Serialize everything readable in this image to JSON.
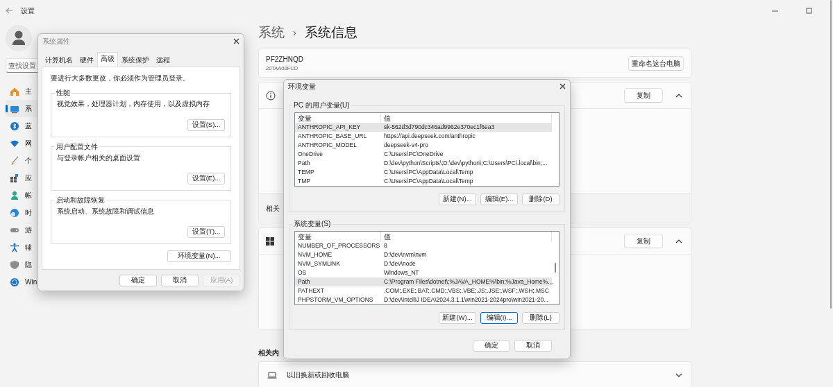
{
  "window": {
    "title": "设置"
  },
  "sidebar": {
    "search": {
      "placeholder": "查找设置"
    },
    "items": [
      {
        "label": "主",
        "selected": false
      },
      {
        "label": "系",
        "selected": true
      },
      {
        "label": "蓝",
        "selected": false
      },
      {
        "label": "网",
        "selected": false
      },
      {
        "label": "个",
        "selected": false
      },
      {
        "label": "应",
        "selected": false
      },
      {
        "label": "帐",
        "selected": false
      },
      {
        "label": "时",
        "selected": false
      },
      {
        "label": "游",
        "selected": false
      },
      {
        "label": "辅",
        "selected": false
      },
      {
        "label": "隐",
        "selected": false
      },
      {
        "label": "Win",
        "selected": false
      }
    ]
  },
  "page": {
    "breadcrumb": [
      "系统",
      "系统信息"
    ],
    "separator": "›",
    "device": {
      "name": "PF2ZHNQD",
      "model": "20TAA00FCD",
      "button": "重命名这台电脑"
    },
    "sections": [
      {
        "kind": "info",
        "button": "复制",
        "expanded": true,
        "footer": "相关"
      },
      {
        "kind": "windows",
        "button": "复制",
        "expanded": true
      }
    ],
    "related_heading": "相关内",
    "related_items": [
      {
        "label": "以旧换新或回收电脑",
        "expanded": false
      }
    ]
  },
  "system_properties": {
    "title": "系统属性",
    "active": false,
    "tabs": [
      {
        "label": "计算机名",
        "selected": false
      },
      {
        "label": "硬件",
        "selected": false
      },
      {
        "label": "高级",
        "selected": true
      },
      {
        "label": "系统保护",
        "selected": false
      },
      {
        "label": "远程",
        "selected": false
      }
    ],
    "notice": "要进行大多数更改，你必须作为管理员登录。",
    "groups": [
      {
        "title": "性能",
        "description": "视觉效果，处理器计划，内存使用，以及虚拟内存",
        "button": "设置(S)..."
      },
      {
        "title": "用户配置文件",
        "description": "与登录帐户相关的桌面设置",
        "button": "设置(E)..."
      },
      {
        "title": "启动和故障恢复",
        "description": "系统启动、系统故障和调试信息",
        "button": "设置(T)..."
      }
    ],
    "env_button": "环境变量(N)...",
    "buttons": [
      {
        "label": "确定",
        "disabled": false
      },
      {
        "label": "取消",
        "disabled": false
      },
      {
        "label": "应用(A)",
        "disabled": true
      }
    ]
  },
  "environment_variables": {
    "title": "环境变量",
    "active": true,
    "lists": [
      {
        "title": "PC 的用户变量(U)",
        "columns": [
          "变量",
          "值"
        ],
        "scrollbar": false,
        "rows": [
          {
            "name": "ANTHROPIC_API_KEY",
            "value": "sk-562d3d790dc346ad9962e370ec1f6ea3",
            "selected": true
          },
          {
            "name": "ANTHROPIC_BASE_URL",
            "value": "https://api.deepseek.com/anthropic",
            "selected": false
          },
          {
            "name": "ANTHROPIC_MODEL",
            "value": "deepseek-v4-pro",
            "selected": false
          },
          {
            "name": "OneDrive",
            "value": "C:\\Users\\PC\\OneDrive",
            "selected": false
          },
          {
            "name": "Path",
            "value": "D:\\dev\\python\\Scripts\\;D:\\dev\\python\\;C:\\Users\\PC\\.local\\bin;...",
            "selected": false
          },
          {
            "name": "TEMP",
            "value": "C:\\Users\\PC\\AppData\\Local\\Temp",
            "selected": false
          },
          {
            "name": "TMP",
            "value": "C:\\Users\\PC\\AppData\\Local\\Temp",
            "selected": false
          }
        ],
        "buttons": [
          {
            "label": "新建(N)...",
            "focused": false
          },
          {
            "label": "编辑(E)...",
            "focused": false
          },
          {
            "label": "删除(D)",
            "focused": false
          }
        ]
      },
      {
        "title": "系统变量(S)",
        "columns": [
          "变量",
          "值"
        ],
        "scrollbar": true,
        "rows": [
          {
            "name": "NUMBER_OF_PROCESSORS",
            "value": "8",
            "selected": false
          },
          {
            "name": "NVM_HOME",
            "value": "D:\\dev\\nvm\\nvm",
            "selected": false
          },
          {
            "name": "NVM_SYMLINK",
            "value": "D:\\dev\\node",
            "selected": false
          },
          {
            "name": "OS",
            "value": "Windows_NT",
            "selected": false
          },
          {
            "name": "Path",
            "value": "C:\\Program Files\\dotnet\\;%JAVA_HOME%\\bin;%Java_Home%...",
            "selected": true
          },
          {
            "name": "PATHEXT",
            "value": ".COM;.EXE;.BAT;.CMD;.VBS;.VBE;.JS;.JSE;.WSF;.WSH;.MSC",
            "selected": false
          },
          {
            "name": "PHPSTORM_VM_OPTIONS",
            "value": "D:\\dev\\IntelliJ IDEA\\2024.3.1.1\\win2021-2024pro\\win2021-20...",
            "selected": false
          }
        ],
        "buttons": [
          {
            "label": "新建(W)...",
            "focused": false
          },
          {
            "label": "编辑(I)...",
            "focused": true
          },
          {
            "label": "删除(L)",
            "focused": false
          }
        ]
      }
    ],
    "buttons": [
      {
        "label": "确定",
        "focused": false
      },
      {
        "label": "取消",
        "focused": false
      }
    ]
  }
}
